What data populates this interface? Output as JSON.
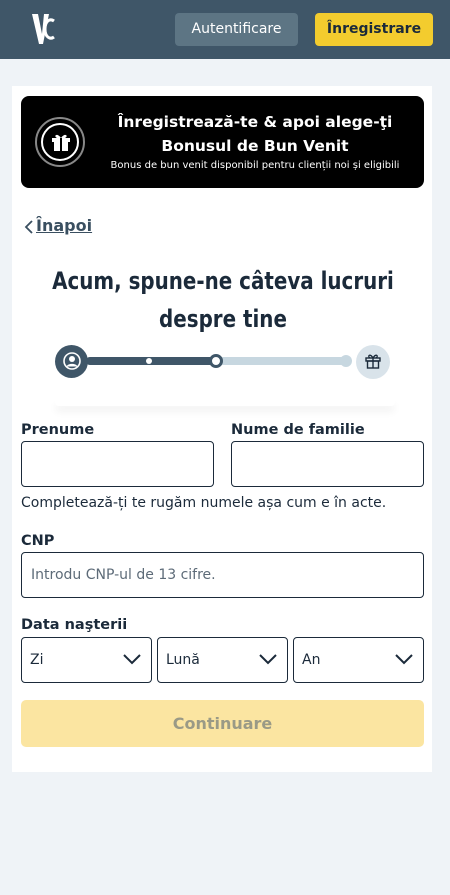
{
  "header": {
    "logo_text": "VC",
    "login_label": "Autentificare",
    "register_label": "Înregistrare"
  },
  "banner": {
    "title": "Înregistrează-te & apoi alege-ţi Bonusul de Bun Venit",
    "subtitle": "Bonus de bun venit disponibil pentru clienții noi și eligibili"
  },
  "nav": {
    "back_label": "Înapoi"
  },
  "page": {
    "heading": "Acum, spune-ne câteva lucruri despre tine"
  },
  "progress": {
    "current_step": 2,
    "total_steps": 4
  },
  "form": {
    "first_name_label": "Prenume",
    "last_name_label": "Nume de familie",
    "name_helper": "Completează-ți te rugăm numele așa cum e în acte.",
    "cnp_label": "CNP",
    "cnp_placeholder": "Introdu CNP-ul de 13 cifre.",
    "dob_label": "Data naşterii",
    "day_value": "Zi",
    "month_value": "Lună",
    "year_value": "An",
    "continue_label": "Continuare"
  },
  "colors": {
    "header_bg": "#3f5668",
    "accent_yellow": "#f3cc2e",
    "disabled_button": "#fbe5a1"
  }
}
